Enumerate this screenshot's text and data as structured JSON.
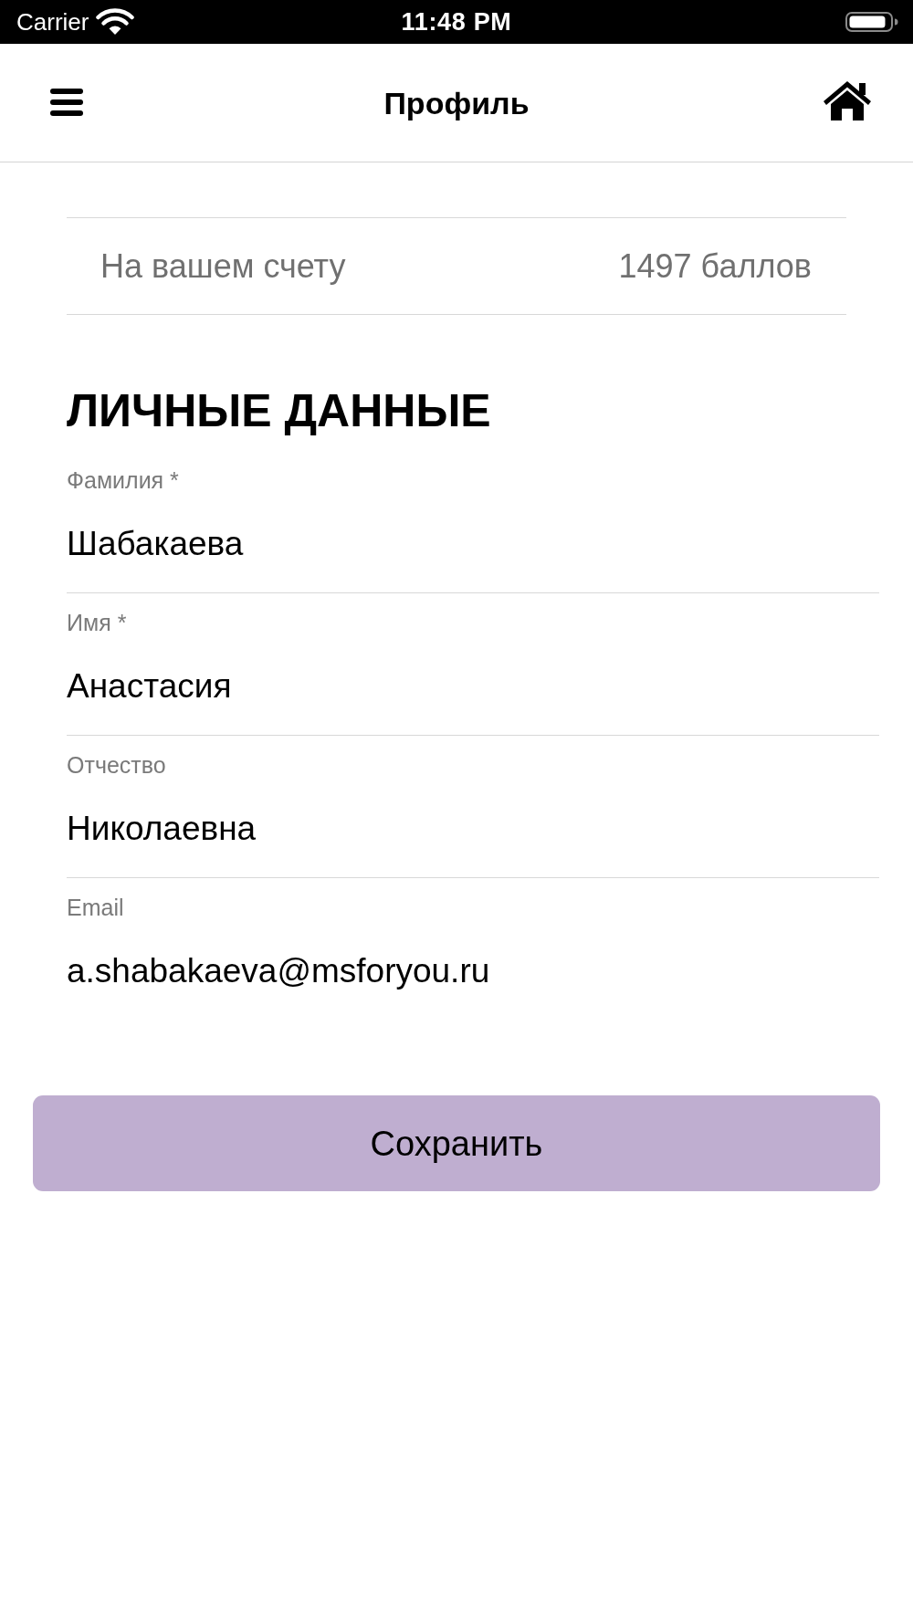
{
  "status_bar": {
    "carrier": "Carrier",
    "time": "11:48 PM"
  },
  "nav_bar": {
    "title": "Профиль"
  },
  "balance": {
    "label": "На вашем счету",
    "value": "1497 баллов"
  },
  "section_title": "ЛИЧНЫЕ ДАННЫЕ",
  "fields": [
    {
      "label": "Фамилия *",
      "value": "Шабакаева"
    },
    {
      "label": "Имя *",
      "value": "Анастасия"
    },
    {
      "label": "Отчество",
      "value": "Николаевна"
    },
    {
      "label": "Email",
      "value": "a.shabakaeva@msforyou.ru"
    }
  ],
  "save_button": {
    "label": "Сохранить"
  }
}
